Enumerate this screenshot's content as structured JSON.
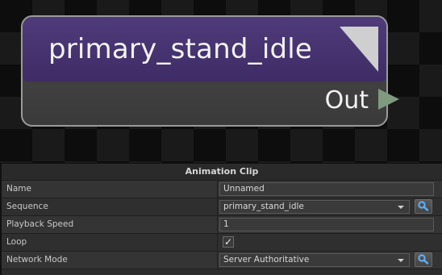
{
  "node": {
    "title": "primary_stand_idle",
    "output_label": "Out"
  },
  "panel": {
    "title": "Animation Clip",
    "rows": [
      {
        "label": "Name",
        "value": "Unnamed"
      },
      {
        "label": "Sequence",
        "value": "primary_stand_idle"
      },
      {
        "label": "Playback Speed",
        "value": "1"
      },
      {
        "label": "Loop",
        "checked": true,
        "check_glyph": "✓"
      },
      {
        "label": "Network Mode",
        "value": "Server Authoritative"
      }
    ]
  },
  "icons": {
    "collapse": "collapse-triangle-icon",
    "output_port": "play-arrow-icon",
    "find": "magnifier-icon"
  },
  "colors": {
    "node_header": "#4f3b7a",
    "node_body": "#404040",
    "port": "#7f9a7f"
  }
}
